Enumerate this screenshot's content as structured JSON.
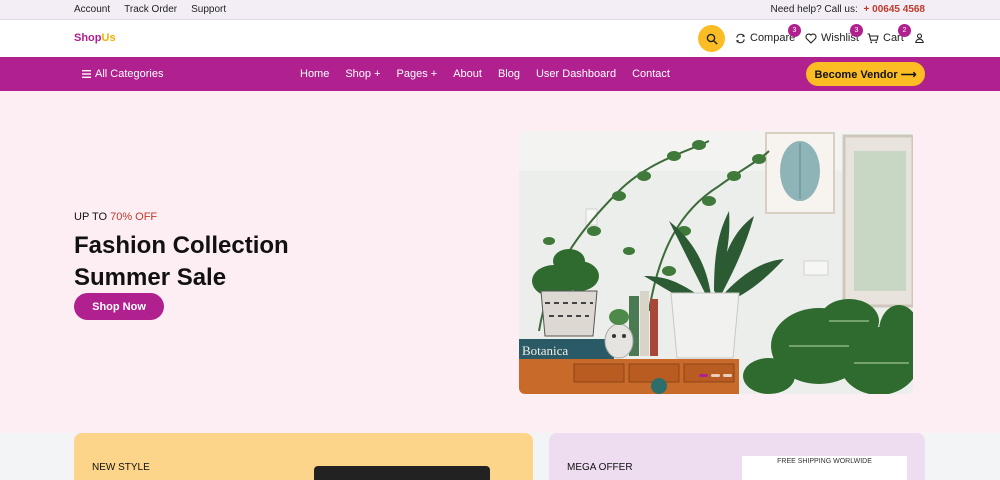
{
  "topbar": {
    "links": [
      "Account",
      "Track Order",
      "Support"
    ],
    "help_text": "Need help? Call us:",
    "phone": "+ 00645 4568"
  },
  "header": {
    "logo_part1": "Shop",
    "logo_part2": "Us",
    "compare_label": "Compare",
    "compare_count": "3",
    "wishlist_label": "Wishlist",
    "wishlist_count": "3",
    "cart_label": "Cart",
    "cart_count": "2"
  },
  "nav": {
    "all_categories": "All Categories",
    "items": [
      "Home",
      "Shop +",
      "Pages +",
      "About",
      "Blog",
      "User Dashboard",
      "Contact"
    ],
    "vendor_button": "Become Vendor ⟶"
  },
  "hero": {
    "subtitle_prefix": "UP TO ",
    "subtitle_percent": "70% OFF",
    "title_line1": "Fashion Collection",
    "title_line2": "Summer Sale",
    "button": "Shop Now",
    "book_label": "Botanica",
    "slide_count": 3,
    "active_slide": 1
  },
  "promos": {
    "card1_label": "NEW STYLE",
    "card2_label": "MEGA OFFER",
    "card2_banner": "FREE SHIPPING WORLWIDE"
  },
  "colors": {
    "brand": "#b0208f",
    "accent": "#fbbd23",
    "hero_bg": "#fdeef3"
  }
}
